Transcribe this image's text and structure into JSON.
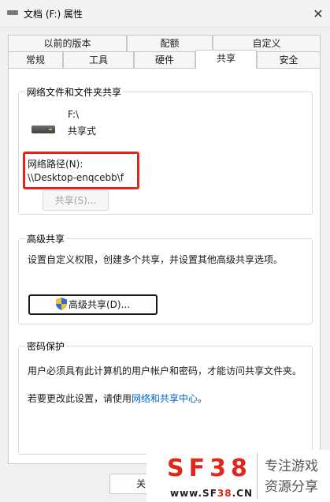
{
  "window": {
    "title": "文档 (F:) 属性",
    "close_glyph": "✕"
  },
  "tabs_back": [
    "以前的版本",
    "配额",
    "自定义"
  ],
  "tabs_front": [
    "常规",
    "工具",
    "硬件",
    "共享",
    "安全"
  ],
  "active_tab": "共享",
  "network_sharing": {
    "title": "网络文件和文件夹共享",
    "drive_name": "F:\\",
    "drive_status": "共享式",
    "path_label": "网络路径(N):",
    "path_value": "\\\\Desktop-enqcebb\\f",
    "share_button": "共享(S)..."
  },
  "advanced_sharing": {
    "title": "高级共享",
    "description": "设置自定义权限，创建多个共享，并设置其他高级共享选项。",
    "button": "高级共享(D)..."
  },
  "password_protection": {
    "title": "密码保护",
    "description": "用户必须具有此计算机的用户帐户和密码，才能访问共享文件夹。",
    "change_text": "若要更改此设置，请使用",
    "link_text": "网络和共享中心",
    "period": "。"
  },
  "footer": {
    "close_button_partial": "关"
  },
  "watermark": {
    "logo": "SF38",
    "site_prefix": "www.SF",
    "site_number": "38",
    "site_suffix": ".CN",
    "slogan_line1": "专注游戏",
    "slogan_line2": "资源分享"
  },
  "colors": {
    "highlight_red": "#e1261c",
    "link_blue": "#0066cc"
  }
}
